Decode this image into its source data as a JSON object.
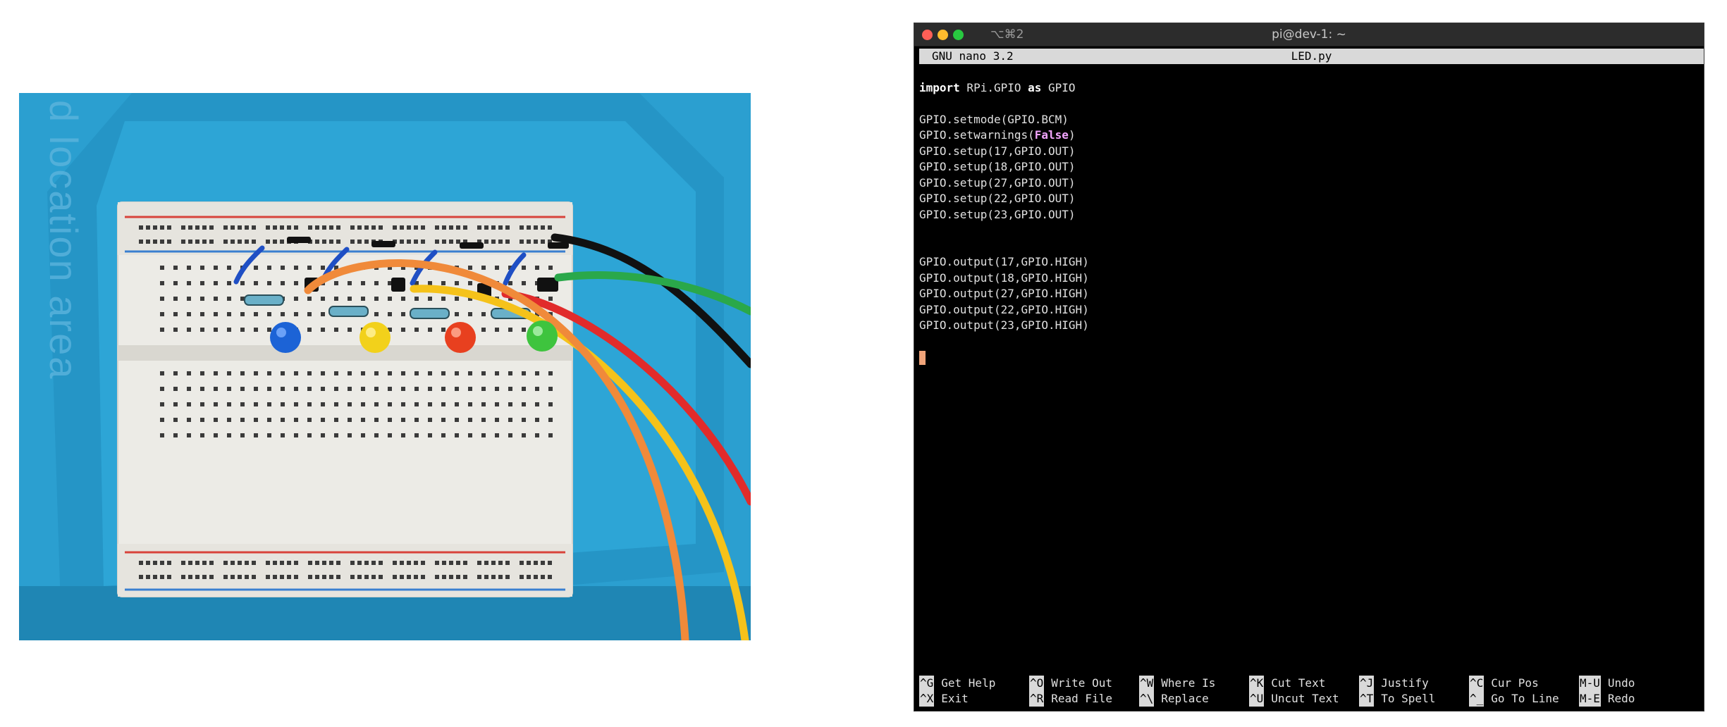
{
  "photo": {
    "mat_text": "d location area",
    "led_colors": {
      "blue": "#1c63d6",
      "yellow": "#f2d11b",
      "red": "#e8401f",
      "green": "#3ec43e"
    },
    "wire_colors": {
      "orange": "#f08a3a",
      "yellow": "#f5c21a",
      "red": "#e12b2b",
      "green": "#2aa84a",
      "black": "#111111"
    },
    "mat_color": "#2b9fd0"
  },
  "terminal": {
    "tab_shortcut": "⌥⌘2",
    "title": "pi@dev-1: ~",
    "nano_version": "GNU nano 3.2",
    "filename": "LED.py",
    "code": {
      "line1_kw_import": "import",
      "line1_mod": " RPi.GPIO ",
      "line1_kw_as": "as",
      "line1_alias": " GPIO",
      "setmode": "GPIO.setmode(GPIO.BCM)",
      "setwarnings_pre": "GPIO.setwarnings(",
      "setwarnings_arg": "False",
      "setwarnings_post": ")",
      "setup": [
        "GPIO.setup(17,GPIO.OUT)",
        "GPIO.setup(18,GPIO.OUT)",
        "GPIO.setup(27,GPIO.OUT)",
        "GPIO.setup(22,GPIO.OUT)",
        "GPIO.setup(23,GPIO.OUT)"
      ],
      "output": [
        "GPIO.output(17,GPIO.HIGH)",
        "GPIO.output(18,GPIO.HIGH)",
        "GPIO.output(27,GPIO.HIGH)",
        "GPIO.output(22,GPIO.HIGH)",
        "GPIO.output(23,GPIO.HIGH)"
      ]
    },
    "shortcuts": [
      [
        {
          "key": "^G",
          "label": "Get Help"
        },
        {
          "key": "^O",
          "label": "Write Out"
        },
        {
          "key": "^W",
          "label": "Where Is"
        },
        {
          "key": "^K",
          "label": "Cut Text"
        },
        {
          "key": "^J",
          "label": "Justify"
        },
        {
          "key": "^C",
          "label": "Cur Pos"
        },
        {
          "key": "M-U",
          "label": "Undo"
        }
      ],
      [
        {
          "key": "^X",
          "label": "Exit"
        },
        {
          "key": "^R",
          "label": "Read File"
        },
        {
          "key": "^\\",
          "label": "Replace"
        },
        {
          "key": "^U",
          "label": "Uncut Text"
        },
        {
          "key": "^T",
          "label": "To Spell"
        },
        {
          "key": "^_",
          "label": "Go To Line"
        },
        {
          "key": "M-E",
          "label": "Redo"
        }
      ]
    ]
  }
}
